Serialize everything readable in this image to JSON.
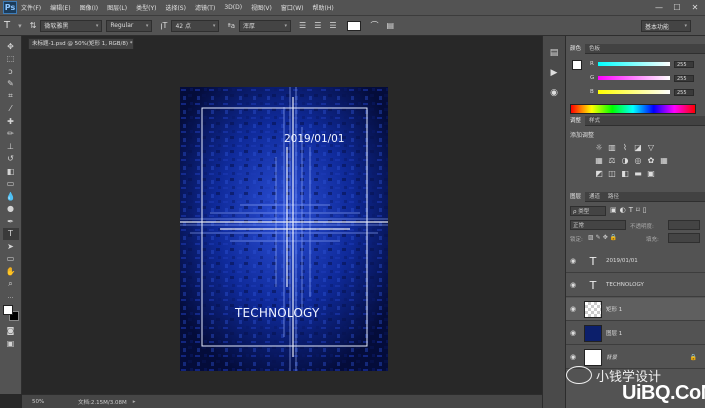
{
  "app": {
    "logo_text": "Ps"
  },
  "menu": [
    "文件(F)",
    "编辑(E)",
    "图像(I)",
    "图层(L)",
    "类型(Y)",
    "选择(S)",
    "滤镜(T)",
    "3D(D)",
    "视图(V)",
    "窗口(W)",
    "帮助(H)"
  ],
  "window_controls": {
    "minimize": "—",
    "maximize": "☐",
    "close": "✕"
  },
  "options": {
    "font_family": "微软雅黑",
    "font_style": "Regular",
    "font_size": "42 点",
    "anti_alias": "浑厚",
    "workspace": "基本功能"
  },
  "document": {
    "tab_label": "未标题-1.psd @ 50%(矩形 1, RGB/8) *",
    "zoom": "50%",
    "doc_info": "文档:2.15M/3.08M"
  },
  "artboard": {
    "date_text": "2019/01/01",
    "title_text": "TECHNOLOGY"
  },
  "color_panel": {
    "tabs": [
      "颜色",
      "色板"
    ],
    "r_label": "R",
    "g_label": "G",
    "b_label": "B",
    "r_value": "255",
    "g_value": "255",
    "b_value": "255"
  },
  "adjust_panel": {
    "tabs": [
      "调整",
      "样式"
    ],
    "title": "添加调整"
  },
  "layers_panel": {
    "tabs": [
      "图层",
      "通道",
      "路径"
    ],
    "filter_kind": "ρ 类型",
    "blend_mode": "正常",
    "opacity_label": "不透明度:",
    "lock_label": "锁定:",
    "fill_label": "填充:",
    "layers": [
      {
        "name": "2019/01/01",
        "kind": "text"
      },
      {
        "name": "TECHNOLOGY",
        "kind": "text"
      },
      {
        "name": "矩形 1",
        "kind": "checker"
      },
      {
        "name": "图层 1",
        "kind": "blue"
      },
      {
        "name": "背景",
        "kind": "white"
      }
    ]
  },
  "watermark": {
    "cn_text": "小钱学设计",
    "logo_text": "UiBQ.CoM"
  },
  "colors": {
    "artboard_bg": "#0a1a5c",
    "ui_panel": "#535353",
    "ui_dark": "#282828"
  }
}
